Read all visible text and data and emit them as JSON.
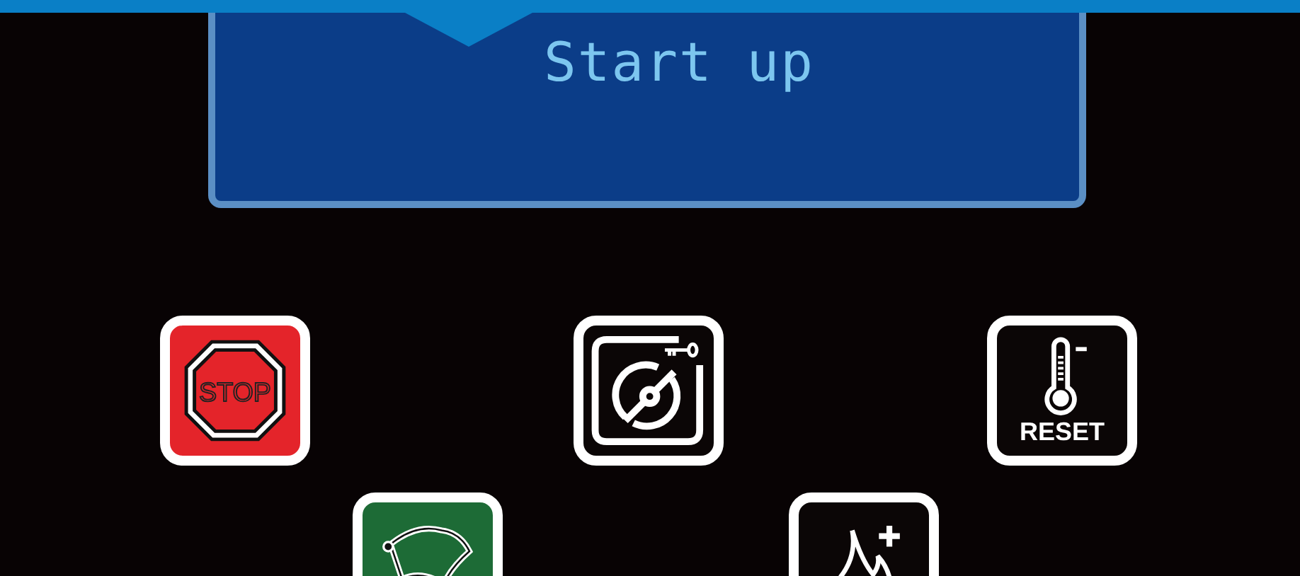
{
  "display": {
    "title": "Start up"
  },
  "button_rows": [
    [
      {
        "kind": "stop",
        "label": "STOP"
      },
      {
        "kind": "key"
      },
      {
        "kind": "reset",
        "label": "RESET"
      }
    ],
    [
      {
        "kind": "flag"
      },
      {
        "kind": "flame"
      }
    ]
  ]
}
